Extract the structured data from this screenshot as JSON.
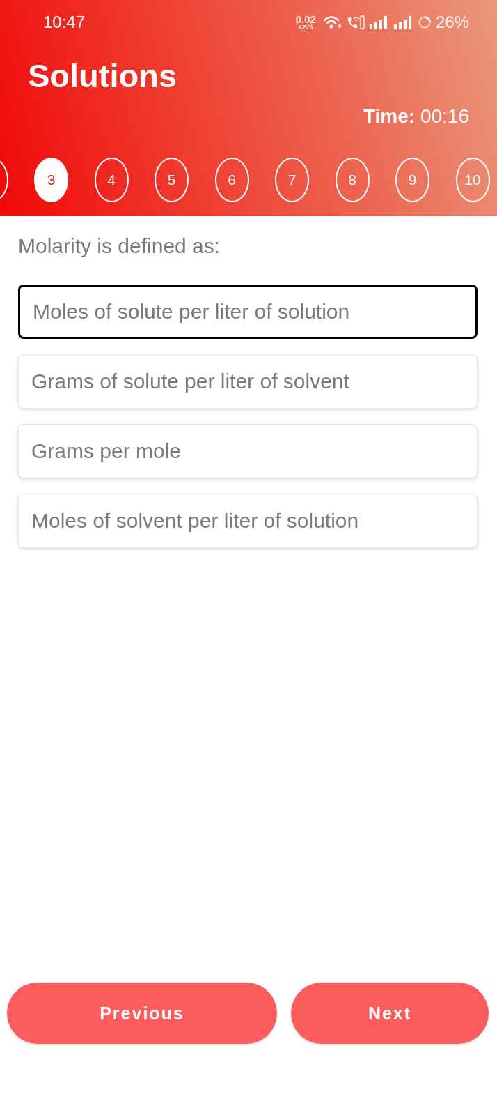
{
  "status_bar": {
    "time": "10:47",
    "net_speed": "0.02",
    "net_unit": "KB/S",
    "battery": "26%"
  },
  "header": {
    "title": "Solutions",
    "timer": "**Time:** 00:16"
  },
  "question_nav": [
    {
      "kind": "partial",
      "selected": false
    },
    {
      "kind": "number",
      "label": "3",
      "selected": true
    },
    {
      "kind": "number",
      "label": "4",
      "selected": false
    },
    {
      "kind": "number",
      "label": "5",
      "selected": false
    },
    {
      "kind": "number",
      "label": "6",
      "selected": false
    },
    {
      "kind": "number",
      "label": "7",
      "selected": false
    },
    {
      "kind": "number",
      "label": "8",
      "selected": false
    },
    {
      "kind": "number",
      "label": "9",
      "selected": false
    },
    {
      "kind": "number",
      "label": "10",
      "selected": false
    }
  ],
  "question": {
    "text": "Molarity is defined as:"
  },
  "options": [
    {
      "text": "Moles of solute per liter of solution",
      "selected": true
    },
    {
      "text": "Grams of solute per liter of solvent",
      "selected": false
    },
    {
      "text": "Grams per mole",
      "selected": false
    },
    {
      "text": "Moles of solvent per liter of solution",
      "selected": false
    }
  ],
  "buttons": [
    {
      "label": "Previous"
    },
    {
      "label": "Next"
    }
  ]
}
